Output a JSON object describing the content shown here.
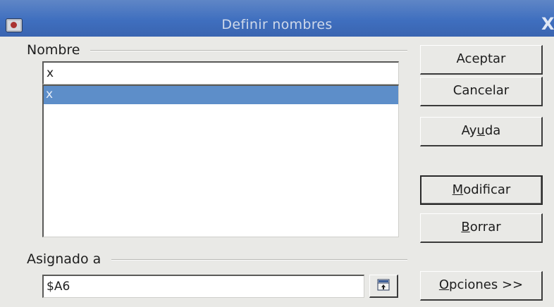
{
  "window": {
    "title": "Definir nombres",
    "close_glyph": "X"
  },
  "nombre": {
    "label": "Nombre",
    "input_value": "x",
    "list_items": [
      {
        "label": "x",
        "selected": true
      }
    ]
  },
  "asignado": {
    "label": "Asignado a",
    "value": "$A6",
    "shrink_icon": "shrink-icon"
  },
  "buttons": {
    "aceptar": "Aceptar",
    "cancelar": "Cancelar",
    "ayuda": {
      "pre": "Ay",
      "mnemonic": "u",
      "post": "da"
    },
    "modificar": {
      "mnemonic": "M",
      "post": "odificar"
    },
    "borrar": {
      "mnemonic": "B",
      "post": "orrar"
    },
    "opciones": {
      "mnemonic": "O",
      "post": "pciones >>"
    }
  },
  "colors": {
    "titlebar": "#3f6fbf",
    "selection": "#5d8ec9",
    "background": "#e9e9e6"
  }
}
